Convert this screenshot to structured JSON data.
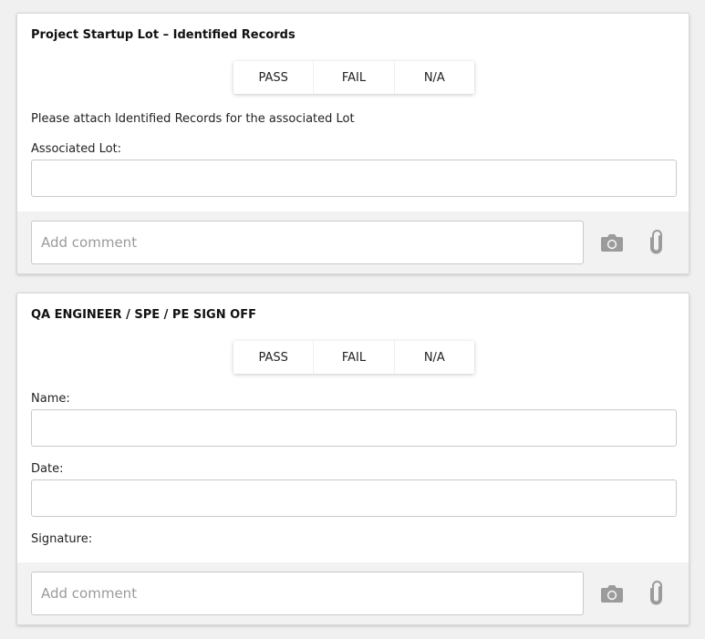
{
  "sections": [
    {
      "title": "Project Startup Lot – Identified Records",
      "options": [
        "PASS",
        "FAIL",
        "N/A"
      ],
      "instruction": "Please attach Identified Records for the associated Lot",
      "fields": [
        {
          "label": "Associated Lot:",
          "value": ""
        }
      ],
      "comment_placeholder": "Add comment"
    },
    {
      "title": "QA ENGINEER / SPE / PE SIGN OFF",
      "options": [
        "PASS",
        "FAIL",
        "N/A"
      ],
      "fields": [
        {
          "label": "Name:",
          "value": ""
        },
        {
          "label": "Date:",
          "value": ""
        }
      ],
      "signature_label": "Signature:",
      "comment_placeholder": "Add comment"
    }
  ],
  "icons": {
    "camera": "camera-icon",
    "attach": "paperclip-icon"
  },
  "colors": {
    "page_background": "#f0f0f0",
    "card_background": "#ffffff",
    "comment_bar": "#f2f2f2",
    "icon_gray": "#9b9b9b"
  }
}
